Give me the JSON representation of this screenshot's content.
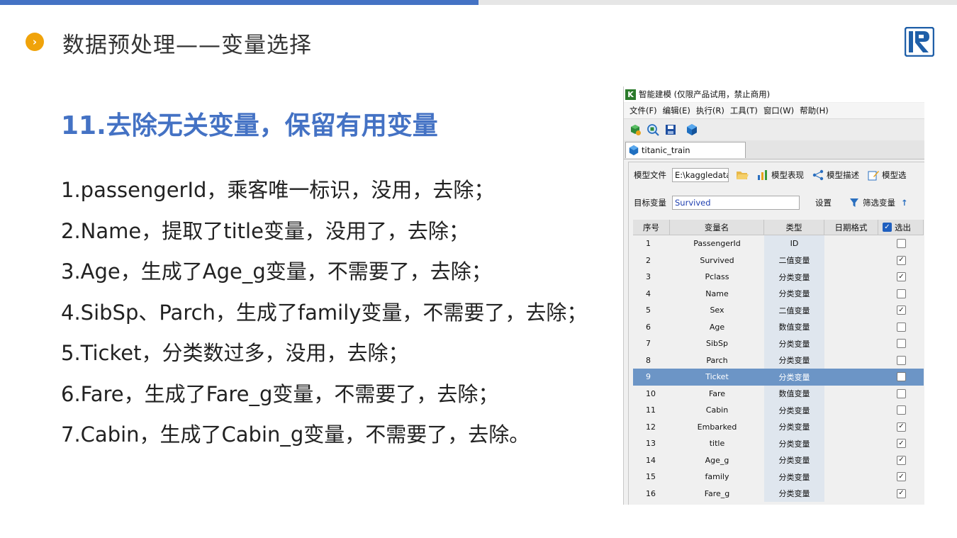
{
  "slide": {
    "header_title": "数据预处理——变量选择",
    "bullet_glyph": "›",
    "subtitle": "11.去除无关变量，保留有用变量",
    "points": [
      "1.passengerId，乘客唯一标识，没用，去除；",
      "2.Name，提取了title变量，没用了，去除；",
      "3.Age，生成了Age_g变量，不需要了，去除；",
      "4.SibSp、Parch，生成了family变量，不需要了，去除；",
      "5.Ticket，分类数过多，没用，去除；",
      "6.Fare，生成了Fare_g变量，不需要了，去除；",
      "7.Cabin，生成了Cabin_g变量，不需要了，去除。"
    ],
    "colors": {
      "accent": "#4472c4",
      "bullet": "#f0a30a"
    }
  },
  "window": {
    "title": "智能建模 (仅限产品试用，禁止商用)",
    "icon_letter": "K",
    "menu": [
      "文件(F)",
      "编辑(E)",
      "执行(R)",
      "工具(T)",
      "窗口(W)",
      "帮助(H)"
    ],
    "toolbar_icons": [
      "cube-run-icon",
      "search-cube-icon",
      "save-icon",
      "cube-icon"
    ],
    "tab_label": "titanic_train",
    "model_file_label": "模型文件",
    "model_file_value": "E:\\kaggledata\\",
    "model_actions": [
      "模型表现",
      "模型描述",
      "模型选"
    ],
    "target_label": "目标变量",
    "target_value": "Survived",
    "settings_label": "设置",
    "filter_label": "筛选变量",
    "columns": [
      "序号",
      "变量名",
      "类型",
      "日期格式",
      "选出"
    ],
    "rows": [
      {
        "idx": "1",
        "name": "PassengerId",
        "type": "ID",
        "date": "",
        "checked": false
      },
      {
        "idx": "2",
        "name": "Survived",
        "type": "二值变量",
        "date": "",
        "checked": true
      },
      {
        "idx": "3",
        "name": "Pclass",
        "type": "分类变量",
        "date": "",
        "checked": true
      },
      {
        "idx": "4",
        "name": "Name",
        "type": "分类变量",
        "date": "",
        "checked": false
      },
      {
        "idx": "5",
        "name": "Sex",
        "type": "二值变量",
        "date": "",
        "checked": true
      },
      {
        "idx": "6",
        "name": "Age",
        "type": "数值变量",
        "date": "",
        "checked": false
      },
      {
        "idx": "7",
        "name": "SibSp",
        "type": "分类变量",
        "date": "",
        "checked": false
      },
      {
        "idx": "8",
        "name": "Parch",
        "type": "分类变量",
        "date": "",
        "checked": false
      },
      {
        "idx": "9",
        "name": "Ticket",
        "type": "分类变量",
        "date": "",
        "checked": false
      },
      {
        "idx": "10",
        "name": "Fare",
        "type": "数值变量",
        "date": "",
        "checked": false
      },
      {
        "idx": "11",
        "name": "Cabin",
        "type": "分类变量",
        "date": "",
        "checked": false
      },
      {
        "idx": "12",
        "name": "Embarked",
        "type": "分类变量",
        "date": "",
        "checked": true
      },
      {
        "idx": "13",
        "name": "title",
        "type": "分类变量",
        "date": "",
        "checked": true
      },
      {
        "idx": "14",
        "name": "Age_g",
        "type": "分类变量",
        "date": "",
        "checked": true
      },
      {
        "idx": "15",
        "name": "family",
        "type": "分类变量",
        "date": "",
        "checked": true
      },
      {
        "idx": "16",
        "name": "Fare_g",
        "type": "分类变量",
        "date": "",
        "checked": true
      }
    ],
    "selected_row": "9",
    "check_glyph": "✓",
    "colors": {
      "selected_row": "#6c95c6",
      "type_cell": "#dfe6ee"
    }
  }
}
